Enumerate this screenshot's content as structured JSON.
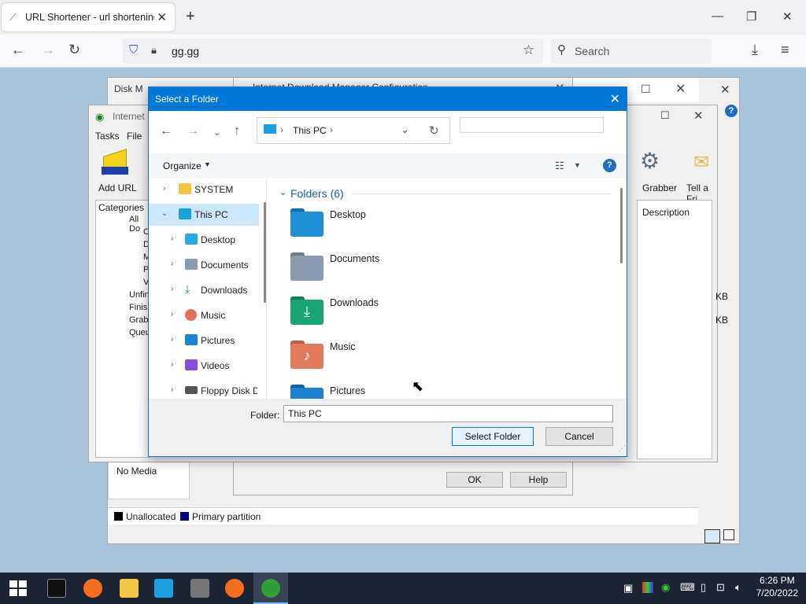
{
  "browser": {
    "tab_title": "URL Shortener - url shortening",
    "url": "gg.gg",
    "search_placeholder": "Search"
  },
  "background": {
    "diskmgmt_title": "Disk M",
    "idm_config_title": "Internet Download Manager Configuration",
    "idm_title": "Internet D",
    "menu": [
      "Tasks",
      "File"
    ],
    "add_url": "Add URL",
    "grabber": "Grabber",
    "tell_friend": "Tell a Fri",
    "categories_header": "Categories",
    "categories": [
      "All Do",
      "C",
      "D",
      "M",
      "P",
      "V",
      "Unfin",
      "Finish",
      "Grabl",
      "Queu"
    ],
    "description_header": "Description",
    "kb_values": [
      "KB",
      "KB"
    ],
    "no_media": "No Media",
    "ok": "OK",
    "help": "Help",
    "legend": [
      "Unallocated",
      "Primary partition"
    ]
  },
  "dialog": {
    "title": "Select a Folder",
    "address": {
      "location": "This PC"
    },
    "organize_label": "Organize",
    "nav_tree": [
      {
        "label": "SYSTEM",
        "icon": "folder-icon",
        "color": "#f5c242"
      },
      {
        "label": "This PC",
        "icon": "pc-icon",
        "color": "#1ba1e2",
        "selected": true
      },
      {
        "label": "Desktop",
        "icon": "desktop-icon",
        "color": "#29a9e0"
      },
      {
        "label": "Documents",
        "icon": "documents-icon",
        "color": "#8a9bb0"
      },
      {
        "label": "Downloads",
        "icon": "downloads-icon",
        "color": "#1a9e6b"
      },
      {
        "label": "Music",
        "icon": "music-icon",
        "color": "#e0705a"
      },
      {
        "label": "Pictures",
        "icon": "pictures-icon",
        "color": "#1b82d1"
      },
      {
        "label": "Videos",
        "icon": "videos-icon",
        "color": "#8a4fd4"
      },
      {
        "label": "Floppy Disk D",
        "icon": "floppy-icon",
        "color": "#555555"
      }
    ],
    "group_header": "Folders (6)",
    "folders": [
      {
        "label": "Desktop",
        "color": "#1e90d6"
      },
      {
        "label": "Documents",
        "color": "#8a9bb0"
      },
      {
        "label": "Downloads",
        "color": "#1aa575"
      },
      {
        "label": "Music",
        "color": "#e07a5a"
      },
      {
        "label": "Pictures",
        "color": "#1b82d1"
      }
    ],
    "folder_label": "Folder:",
    "folder_value": "This PC",
    "select_button": "Select Folder",
    "cancel_button": "Cancel"
  },
  "taskbar": {
    "time": "6:26 PM",
    "date": "7/20/2022"
  },
  "colors": {
    "accent": "#0078d7",
    "taskbar": "#1c2333"
  }
}
